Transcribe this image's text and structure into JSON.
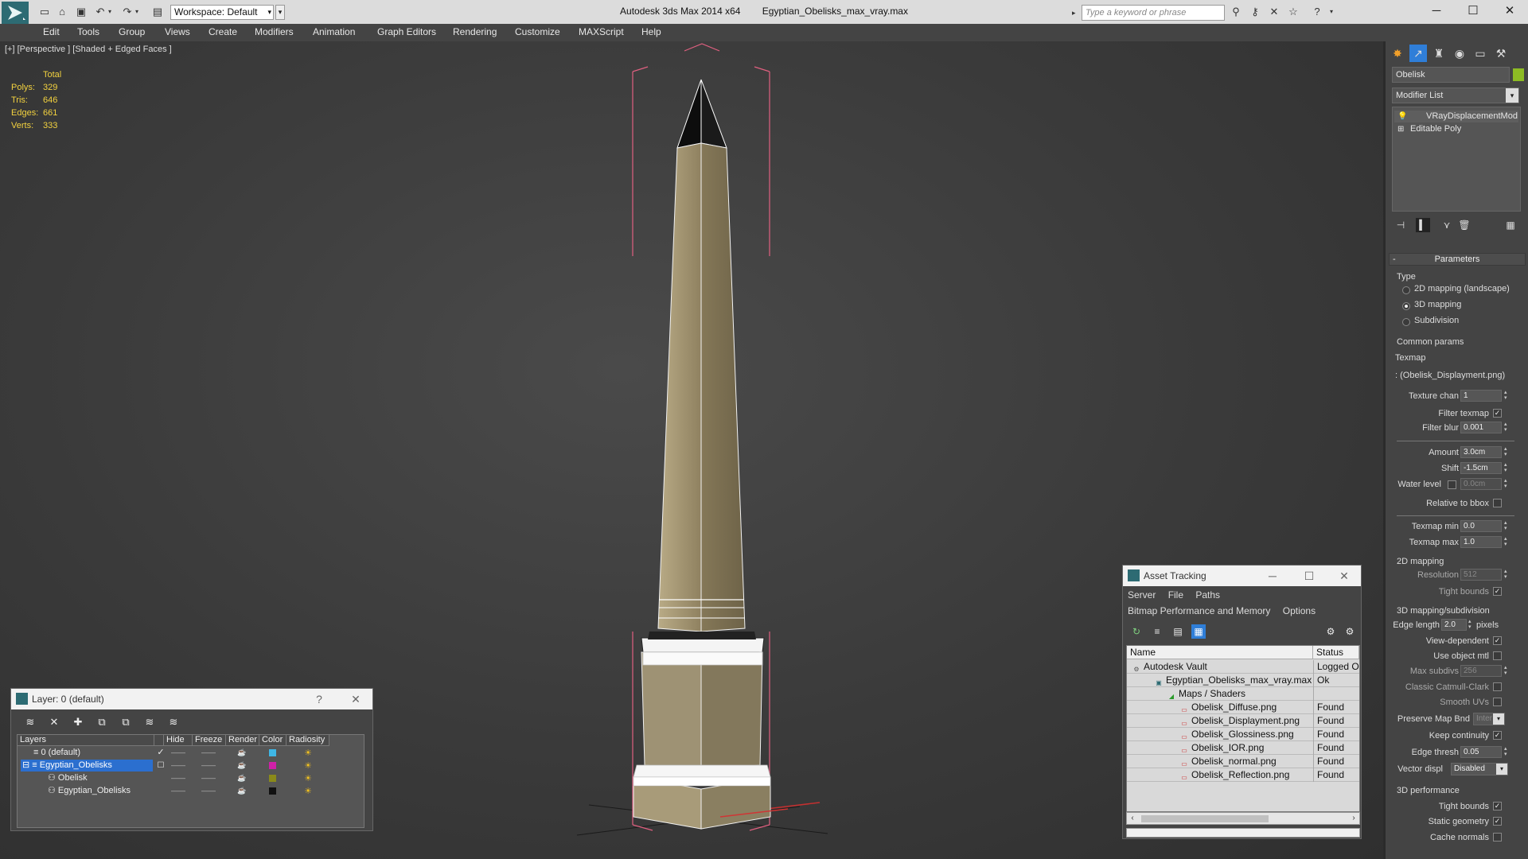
{
  "titlebar": {
    "workspace": "Workspace: Default",
    "app_title": "Autodesk 3ds Max  2014 x64",
    "file_name": "Egyptian_Obelisks_max_vray.max",
    "search_placeholder": "Type a keyword or phrase"
  },
  "menu": [
    "Edit",
    "Tools",
    "Group",
    "Views",
    "Create",
    "Modifiers",
    "Animation",
    "Graph Editors",
    "Rendering",
    "Customize",
    "MAXScript",
    "Help"
  ],
  "viewport": {
    "label": "[+] [Perspective ] [Shaded + Edged Faces ]",
    "stats": {
      "header": "Total",
      "rows": [
        {
          "k": "Polys:",
          "v": "329"
        },
        {
          "k": "Tris:",
          "v": "646"
        },
        {
          "k": "Edges:",
          "v": "661"
        },
        {
          "k": "Verts:",
          "v": "333"
        }
      ]
    }
  },
  "command_panel": {
    "object_name": "Obelisk",
    "object_color": "#8dbb24",
    "modifier_list": "Modifier List",
    "stack": [
      "VRayDisplacementMod",
      "Editable Poly"
    ],
    "rollout_title": "Parameters",
    "type_label": "Type",
    "type_options": [
      "2D mapping (landscape)",
      "3D mapping",
      "Subdivision"
    ],
    "common_params": "Common params",
    "texmap_label": "Texmap",
    "texmap_value": "(Obelisk_Displayment.png)",
    "texture_chan_label": "Texture chan",
    "texture_chan": "1",
    "filter_texmap_label": "Filter texmap",
    "filter_blur_label": "Filter blur",
    "filter_blur": "0.001",
    "amount_label": "Amount",
    "amount": "3.0cm",
    "shift_label": "Shift",
    "shift": "-1.5cm",
    "water_level_label": "Water level",
    "water_level": "0.0cm",
    "relative_bbox_label": "Relative to bbox",
    "texmap_min_label": "Texmap min",
    "texmap_min": "0.0",
    "texmap_max_label": "Texmap max",
    "texmap_max": "1.0",
    "mapping2d_label": "2D mapping",
    "resolution_label": "Resolution",
    "resolution": "512",
    "tight_bounds_label": "Tight bounds",
    "mapping3d_label": "3D mapping/subdivision",
    "edge_length_label": "Edge length",
    "edge_length": "2.0",
    "pixels_label": "pixels",
    "view_dependent_label": "View-dependent",
    "use_object_mtl_label": "Use object mtl",
    "max_subdivs_label": "Max subdivs",
    "max_subdivs": "256",
    "classic_cc_label": "Classic Catmull-Clark",
    "smooth_uvs_label": "Smooth UVs",
    "preserve_map_label": "Preserve Map Bnd",
    "preserve_map": "Inter",
    "keep_continuity_label": "Keep continuity",
    "edge_thresh_label": "Edge thresh",
    "edge_thresh": "0.05",
    "vector_displ_label": "Vector displ",
    "vector_displ": "Disabled",
    "perf_label": "3D performance",
    "perf_tight_label": "Tight bounds",
    "static_geo_label": "Static geometry",
    "cache_normals_label": "Cache normals"
  },
  "layer_dialog": {
    "title": "Layer: 0 (default)",
    "columns": [
      "Layers",
      "Hide",
      "Freeze",
      "Render",
      "Color",
      "Radiosity"
    ],
    "rows": [
      {
        "name": "0 (default)",
        "color": "#3fb7e6"
      },
      {
        "name": "Egyptian_Obelisks",
        "color": "#d021a8"
      },
      {
        "name": "Obelisk",
        "color": "#8a8a1a"
      },
      {
        "name": "Egyptian_Obelisks",
        "color": "#111111"
      }
    ]
  },
  "asset_dialog": {
    "title": "Asset Tracking",
    "menu1": [
      "Server",
      "File",
      "Paths"
    ],
    "menu2": [
      "Bitmap Performance and Memory",
      "Options"
    ],
    "columns": [
      "Name",
      "Status"
    ],
    "rows": [
      {
        "name": "Autodesk Vault",
        "status": "Logged Ou"
      },
      {
        "name": "Egyptian_Obelisks_max_vray.max",
        "status": "Ok"
      },
      {
        "name": "Maps / Shaders",
        "status": ""
      },
      {
        "name": "Obelisk_Diffuse.png",
        "status": "Found"
      },
      {
        "name": "Obelisk_Displayment.png",
        "status": "Found"
      },
      {
        "name": "Obelisk_Glossiness.png",
        "status": "Found"
      },
      {
        "name": "Obelisk_IOR.png",
        "status": "Found"
      },
      {
        "name": "Obelisk_normal.png",
        "status": "Found"
      },
      {
        "name": "Obelisk_Reflection.png",
        "status": "Found"
      }
    ]
  }
}
